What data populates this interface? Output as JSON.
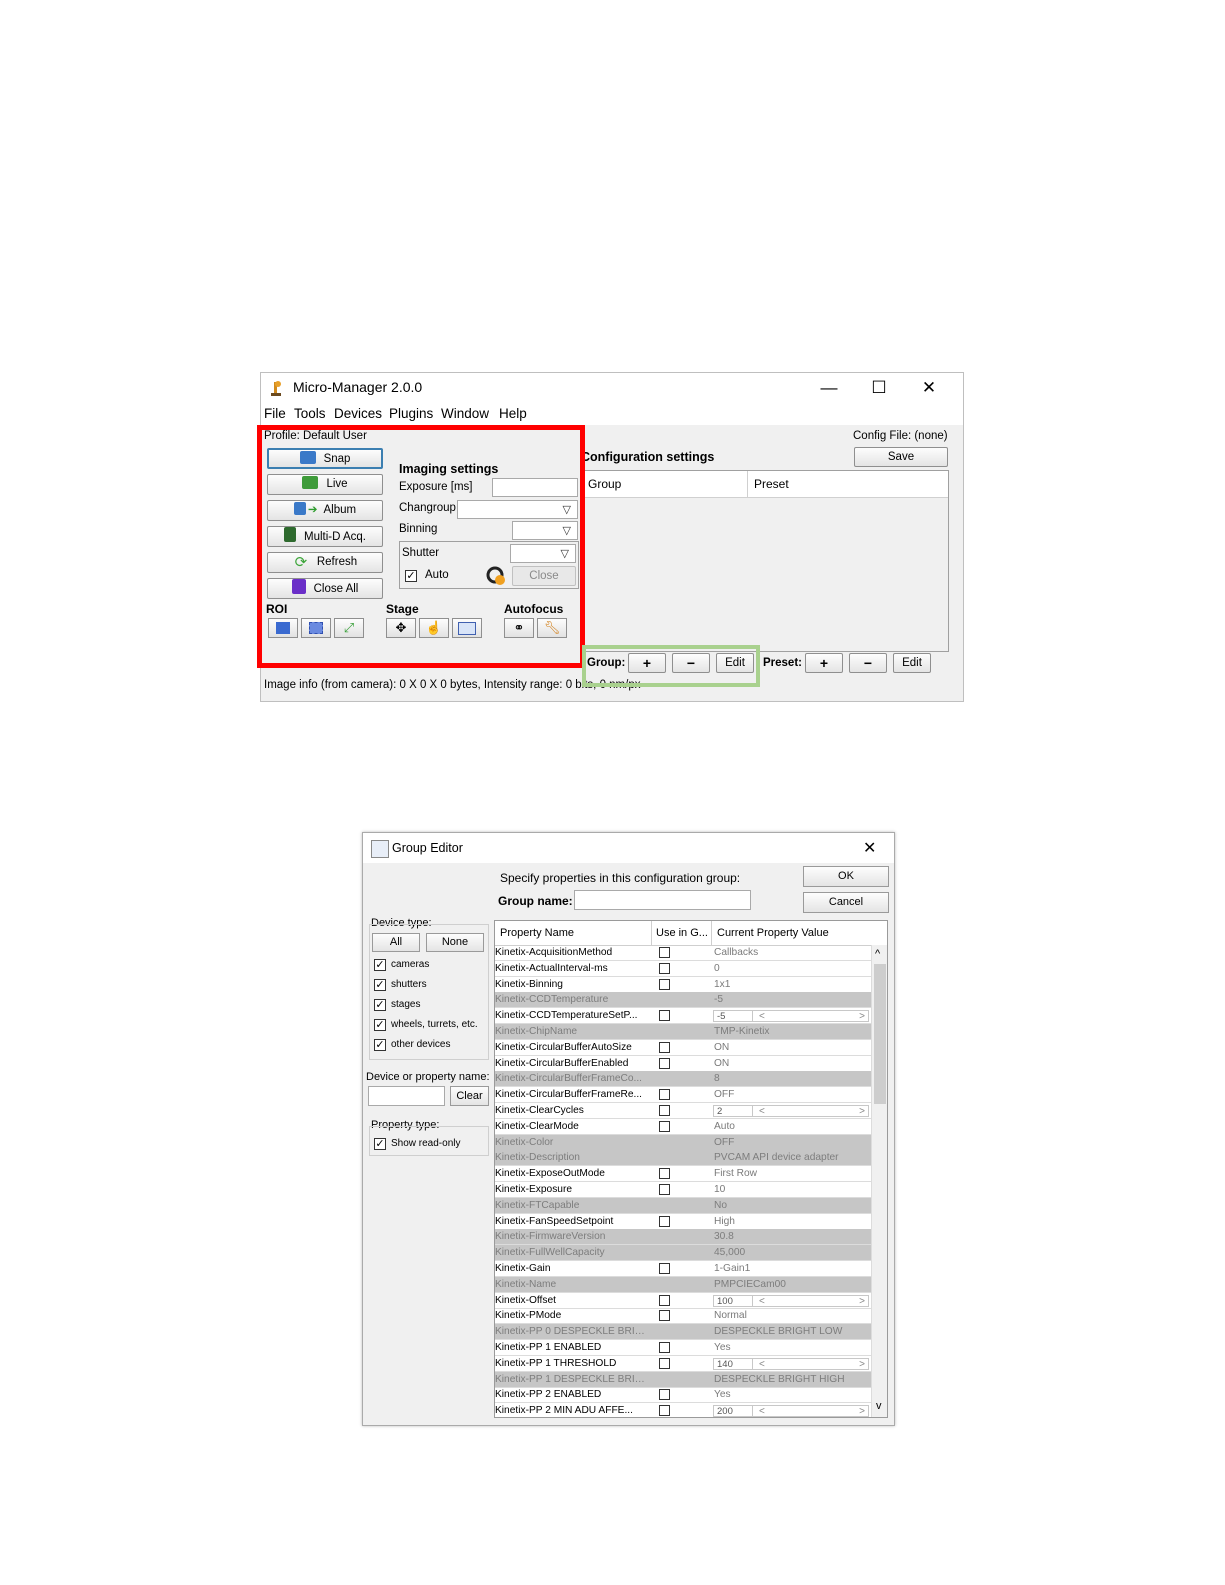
{
  "micromanager": {
    "title": "Micro-Manager 2.0.0",
    "window_controls": {
      "minimize": "—",
      "maximize": "☐",
      "close": "✕"
    },
    "menu": [
      "File",
      "Tools",
      "Devices",
      "Plugins",
      "Window",
      "Help"
    ],
    "profile": "Profile: Default User",
    "config_file": "Config File: (none)",
    "buttons": {
      "snap": "Snap",
      "live": "Live",
      "album": "Album",
      "multid": "Multi-D Acq.",
      "refresh": "Refresh",
      "close_all": "Close All"
    },
    "imaging": {
      "heading": "Imaging settings",
      "exposure_label": "Exposure [ms]",
      "exposure_value": "",
      "changroup_label": "Changroup",
      "binning_label": "Binning",
      "shutter_label": "Shutter",
      "auto_label": "Auto",
      "auto_checked": true,
      "close_label": "Close"
    },
    "sections": {
      "roi": "ROI",
      "stage": "Stage",
      "autofocus": "Autofocus"
    },
    "config": {
      "heading": "Configuration settings",
      "save": "Save",
      "col_group": "Group",
      "col_preset": "Preset",
      "group_label": "Group:",
      "preset_label": "Preset:",
      "plus": "+",
      "minus": "−",
      "edit": "Edit"
    },
    "status": "Image info (from camera): 0 X 0 X 0 bytes, Intensity range: 0 bits, 0 nm/px",
    "highlight_colors": {
      "red": "#ff0000",
      "green": "#a9d18e"
    }
  },
  "group_editor": {
    "title": "Group Editor",
    "close": "✕",
    "specify": "Specify properties in this configuration group:",
    "group_name_label": "Group name:",
    "group_name_value": "",
    "ok": "OK",
    "cancel": "Cancel",
    "device_type_label": "Device type:",
    "all": "All",
    "none": "None",
    "device_types": [
      "cameras",
      "shutters",
      "stages",
      "wheels, turrets, etc.",
      "other devices"
    ],
    "search_label": "Device or property name:",
    "search_value": "",
    "clear": "Clear",
    "property_type_label": "Property type:",
    "show_readonly": "Show read-only",
    "columns": [
      "Property Name",
      "Use in G...",
      "Current Property Value"
    ],
    "rows": [
      {
        "name": "Kinetix-AcquisitionMethod",
        "value": "Callbacks",
        "ro": false
      },
      {
        "name": "Kinetix-ActualInterval-ms",
        "value": "0",
        "ro": false
      },
      {
        "name": "Kinetix-Binning",
        "value": "1x1",
        "ro": false
      },
      {
        "name": "Kinetix-CCDTemperature",
        "value": "-5",
        "ro": true
      },
      {
        "name": "Kinetix-CCDTemperatureSetP...",
        "value": "-5",
        "ro": false,
        "slider": true
      },
      {
        "name": "Kinetix-ChipName",
        "value": "TMP-Kinetix",
        "ro": true
      },
      {
        "name": "Kinetix-CircularBufferAutoSize",
        "value": "ON",
        "ro": false
      },
      {
        "name": "Kinetix-CircularBufferEnabled",
        "value": "ON",
        "ro": false
      },
      {
        "name": "Kinetix-CircularBufferFrameCo...",
        "value": "8",
        "ro": true
      },
      {
        "name": "Kinetix-CircularBufferFrameRe...",
        "value": "OFF",
        "ro": false
      },
      {
        "name": "Kinetix-ClearCycles",
        "value": "2",
        "ro": false,
        "slider": true
      },
      {
        "name": "Kinetix-ClearMode",
        "value": "Auto",
        "ro": false
      },
      {
        "name": "Kinetix-Color",
        "value": "OFF",
        "ro": true
      },
      {
        "name": "Kinetix-Description",
        "value": "PVCAM API device adapter",
        "ro": true
      },
      {
        "name": "Kinetix-ExposeOutMode",
        "value": "First Row",
        "ro": false
      },
      {
        "name": "Kinetix-Exposure",
        "value": "10",
        "ro": false
      },
      {
        "name": "Kinetix-FTCapable",
        "value": "No",
        "ro": true
      },
      {
        "name": "Kinetix-FanSpeedSetpoint",
        "value": "High",
        "ro": false
      },
      {
        "name": "Kinetix-FirmwareVersion",
        "value": "30.8",
        "ro": true
      },
      {
        "name": "Kinetix-FullWellCapacity",
        "value": "45,000",
        "ro": true
      },
      {
        "name": "Kinetix-Gain",
        "value": "1-Gain1",
        "ro": false
      },
      {
        "name": "Kinetix-Name",
        "value": "PMPCIECam00",
        "ro": true
      },
      {
        "name": "Kinetix-Offset",
        "value": "100",
        "ro": false,
        "slider": true
      },
      {
        "name": "Kinetix-PMode",
        "value": "Normal",
        "ro": false
      },
      {
        "name": "Kinetix-PP  0 DESPECKLE BRIG...",
        "value": "DESPECKLE BRIGHT LOW",
        "ro": true
      },
      {
        "name": "Kinetix-PP  1  ENABLED",
        "value": "Yes",
        "ro": false
      },
      {
        "name": "Kinetix-PP  1  THRESHOLD",
        "value": "140",
        "ro": false,
        "slider": true
      },
      {
        "name": "Kinetix-PP  1 DESPECKLE BRIG...",
        "value": "DESPECKLE BRIGHT HIGH",
        "ro": true
      },
      {
        "name": "Kinetix-PP  2  ENABLED",
        "value": "Yes",
        "ro": false
      },
      {
        "name": "Kinetix-PP  2  MIN ADU AFFE...",
        "value": "200",
        "ro": false,
        "slider": true
      }
    ],
    "scroll_up": "^",
    "scroll_down": "v"
  }
}
